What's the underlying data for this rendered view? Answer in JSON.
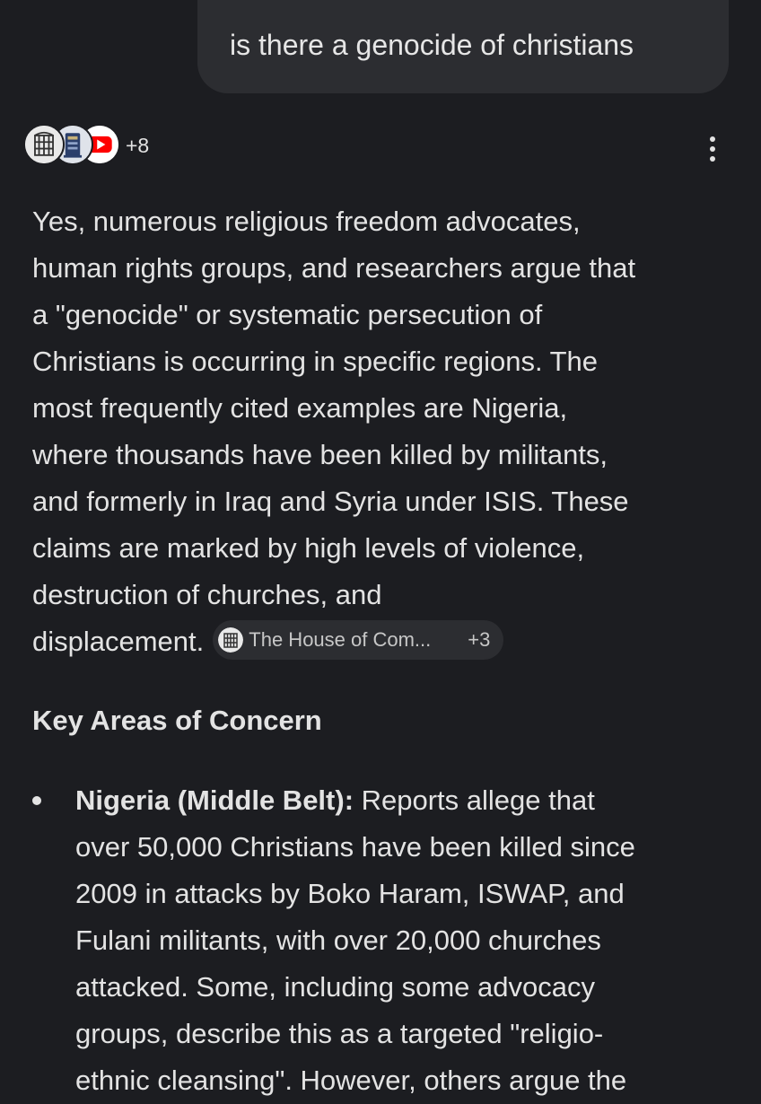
{
  "user_query": "is there a genocide of christians",
  "sources": {
    "icons": [
      "house-of-commons-portcullis-icon",
      "bookshelf-archive-icon",
      "youtube-icon"
    ],
    "more_count": "+8"
  },
  "answer": {
    "lines": [
      "Yes, numerous religious freedom advocates,",
      "human rights groups, and researchers argue that",
      "a \"genocide\" or systematic persecution of",
      "Christians is occurring in specific regions. The",
      "most frequently cited examples are Nigeria,",
      "where thousands have been killed by militants,",
      "and formerly in Iraq and Syria under ISIS. These",
      "claims are marked by high levels of violence,",
      "destruction of churches, and",
      "displacement."
    ],
    "citation_chip": {
      "label": "The House of Com...",
      "more": "+3",
      "icon": "house-of-commons-portcullis-icon"
    }
  },
  "section": {
    "heading": "Key Areas of Concern"
  },
  "bullets": [
    {
      "title": "Nigeria (Middle Belt):",
      "first_line_rest": " Reports allege that",
      "lines": [
        "over 50,000 Christians have been killed since",
        "2009 in attacks by Boko Haram, ISWAP, and",
        "Fulani militants, with over 20,000 churches",
        "attacked. Some, including some advocacy",
        "groups, describe this as a targeted \"religio-",
        "ethnic cleansing\". However, others argue the"
      ]
    }
  ],
  "colors": {
    "background": "#1c1d21",
    "bubble": "#2c2d31",
    "text": "#e3e3e3",
    "youtube_red": "#ff0000"
  }
}
